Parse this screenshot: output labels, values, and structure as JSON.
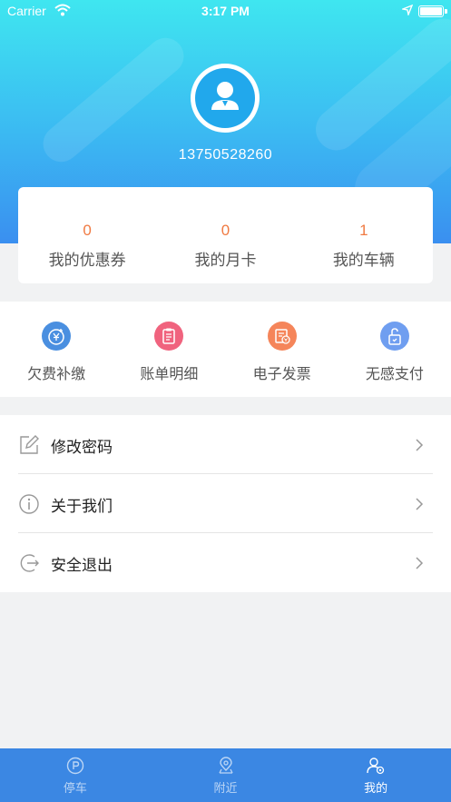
{
  "status_bar": {
    "carrier": "Carrier",
    "time": "3:17 PM"
  },
  "profile": {
    "phone": "13750528260"
  },
  "stats": [
    {
      "value": "0",
      "label": "我的优惠券"
    },
    {
      "value": "0",
      "label": "我的月卡"
    },
    {
      "value": "1",
      "label": "我的车辆"
    }
  ],
  "quick_actions": [
    {
      "label": "欠费补缴",
      "icon": "yuan-coin-icon",
      "color": "#4a8fe0"
    },
    {
      "label": "账单明细",
      "icon": "clipboard-icon",
      "color": "#f0637e"
    },
    {
      "label": "电子发票",
      "icon": "invoice-icon",
      "color": "#f5855a"
    },
    {
      "label": "无感支付",
      "icon": "unlock-icon",
      "color": "#6f9ef0"
    }
  ],
  "menu": [
    {
      "label": "修改密码",
      "icon": "edit-icon"
    },
    {
      "label": "关于我们",
      "icon": "info-icon"
    },
    {
      "label": "安全退出",
      "icon": "logout-icon"
    }
  ],
  "tabbar": [
    {
      "label": "停车",
      "icon": "parking-icon",
      "active": false
    },
    {
      "label": "附近",
      "icon": "location-icon",
      "active": false
    },
    {
      "label": "我的",
      "icon": "user-settings-icon",
      "active": true
    }
  ],
  "colors": {
    "accent": "#3b87e3",
    "stat_value": "#f07a42"
  }
}
